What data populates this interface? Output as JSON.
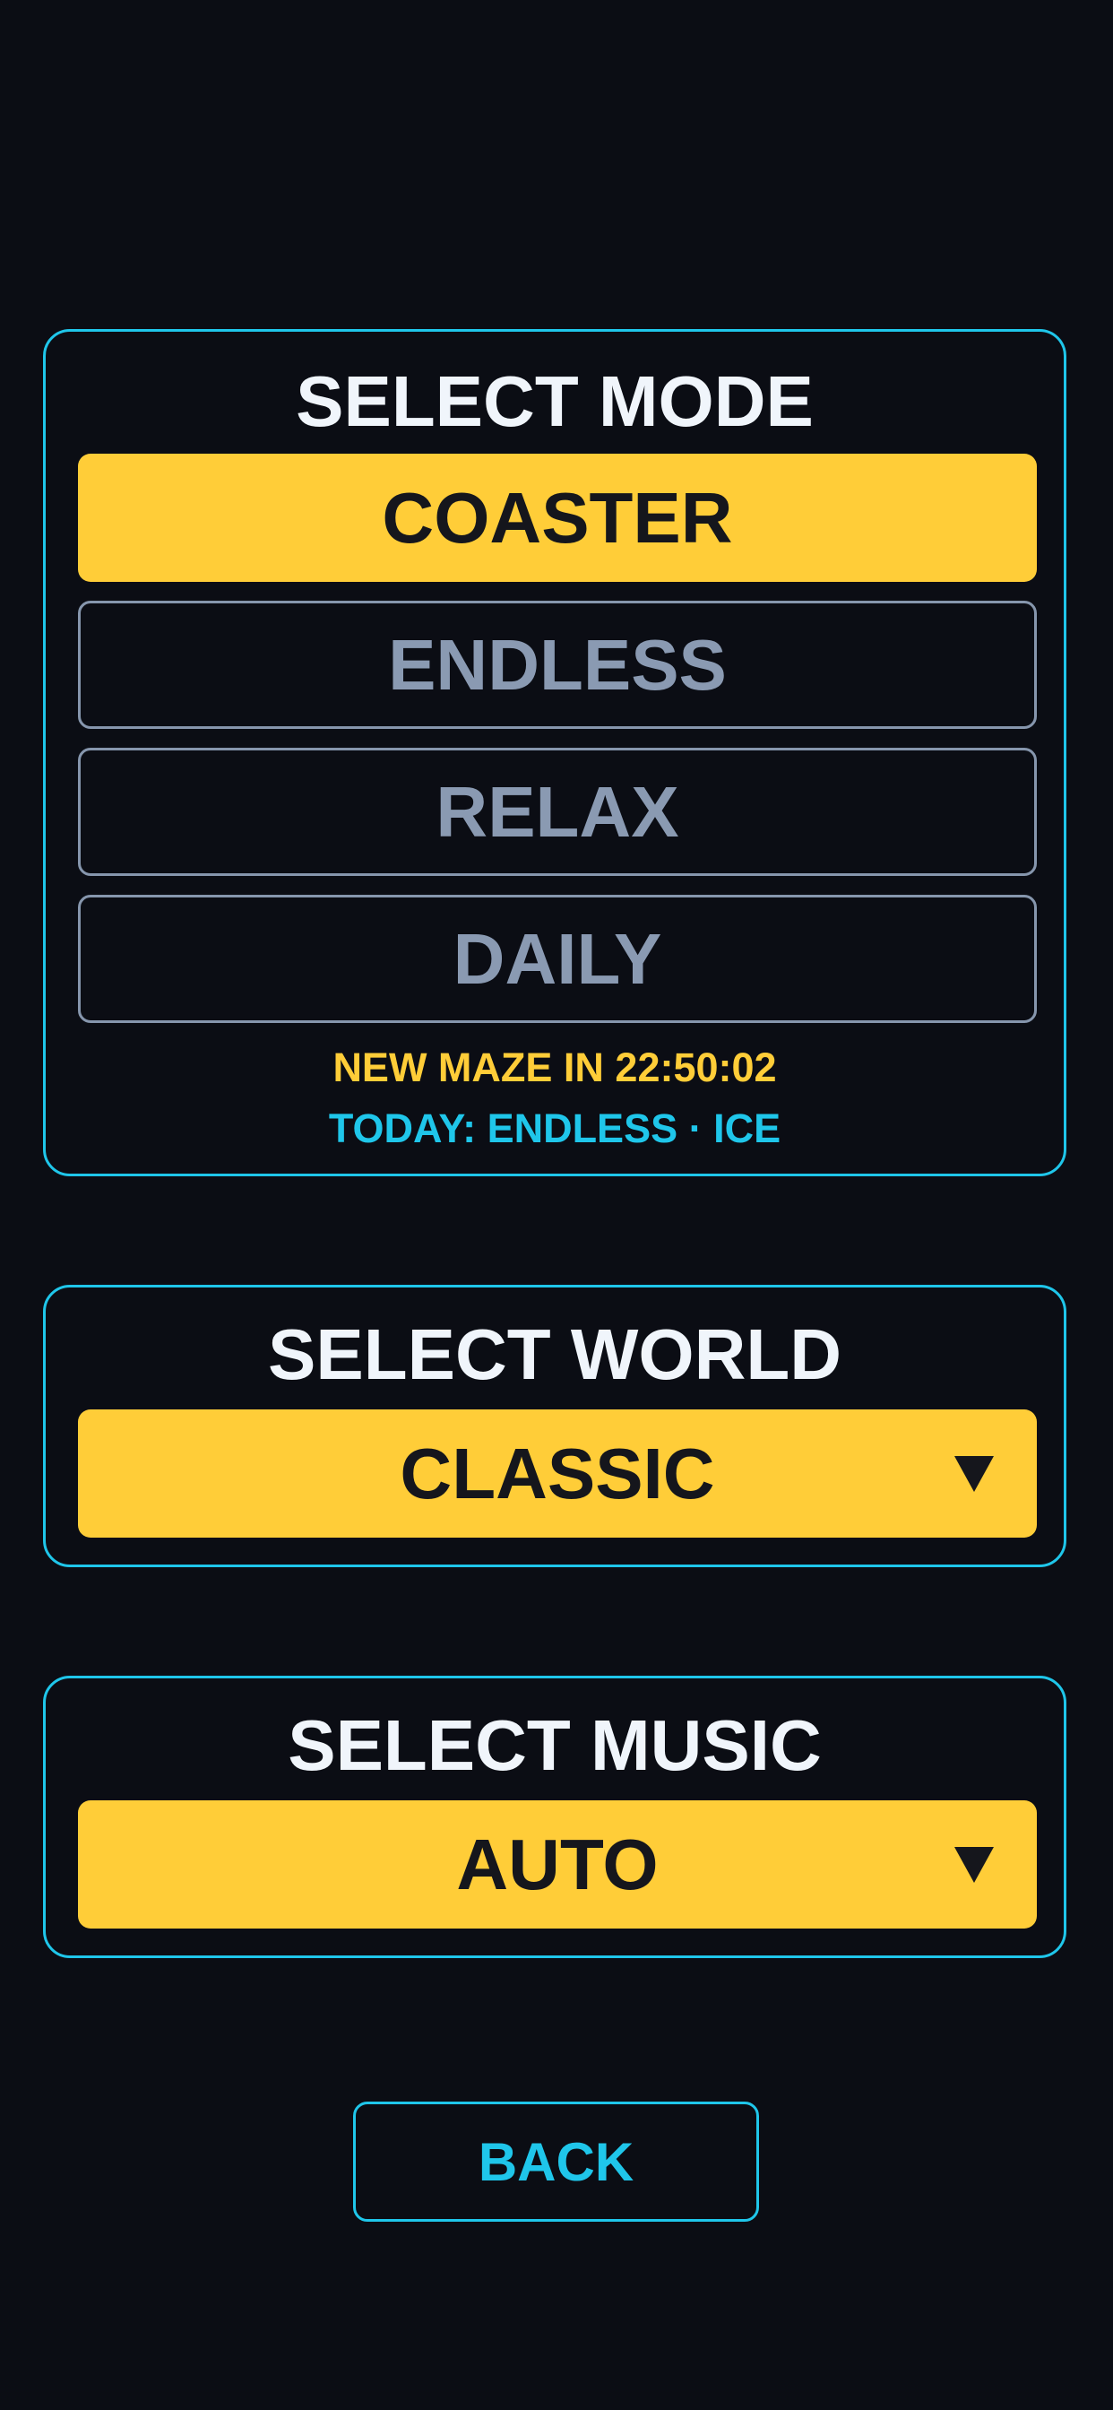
{
  "colors": {
    "background": "#0b0d14",
    "accent_cyan": "#1fc6ea",
    "accent_yellow": "#ffcd38",
    "inactive_gray": "#8a9ab2",
    "title_white": "#f0f5fb"
  },
  "mode": {
    "title": "SELECT MODE",
    "options": [
      {
        "label": "COASTER",
        "selected": true
      },
      {
        "label": "ENDLESS",
        "selected": false
      },
      {
        "label": "RELAX",
        "selected": false
      },
      {
        "label": "DAILY",
        "selected": false
      }
    ],
    "countdown": "NEW MAZE IN 22:50:02",
    "today": "TODAY: ENDLESS · ICE"
  },
  "world": {
    "title": "SELECT WORLD",
    "selected": "CLASSIC",
    "caret_icon": "triangle-down-icon"
  },
  "music": {
    "title": "SELECT MUSIC",
    "selected": "AUTO",
    "caret_icon": "triangle-down-icon"
  },
  "back": {
    "label": "BACK"
  }
}
